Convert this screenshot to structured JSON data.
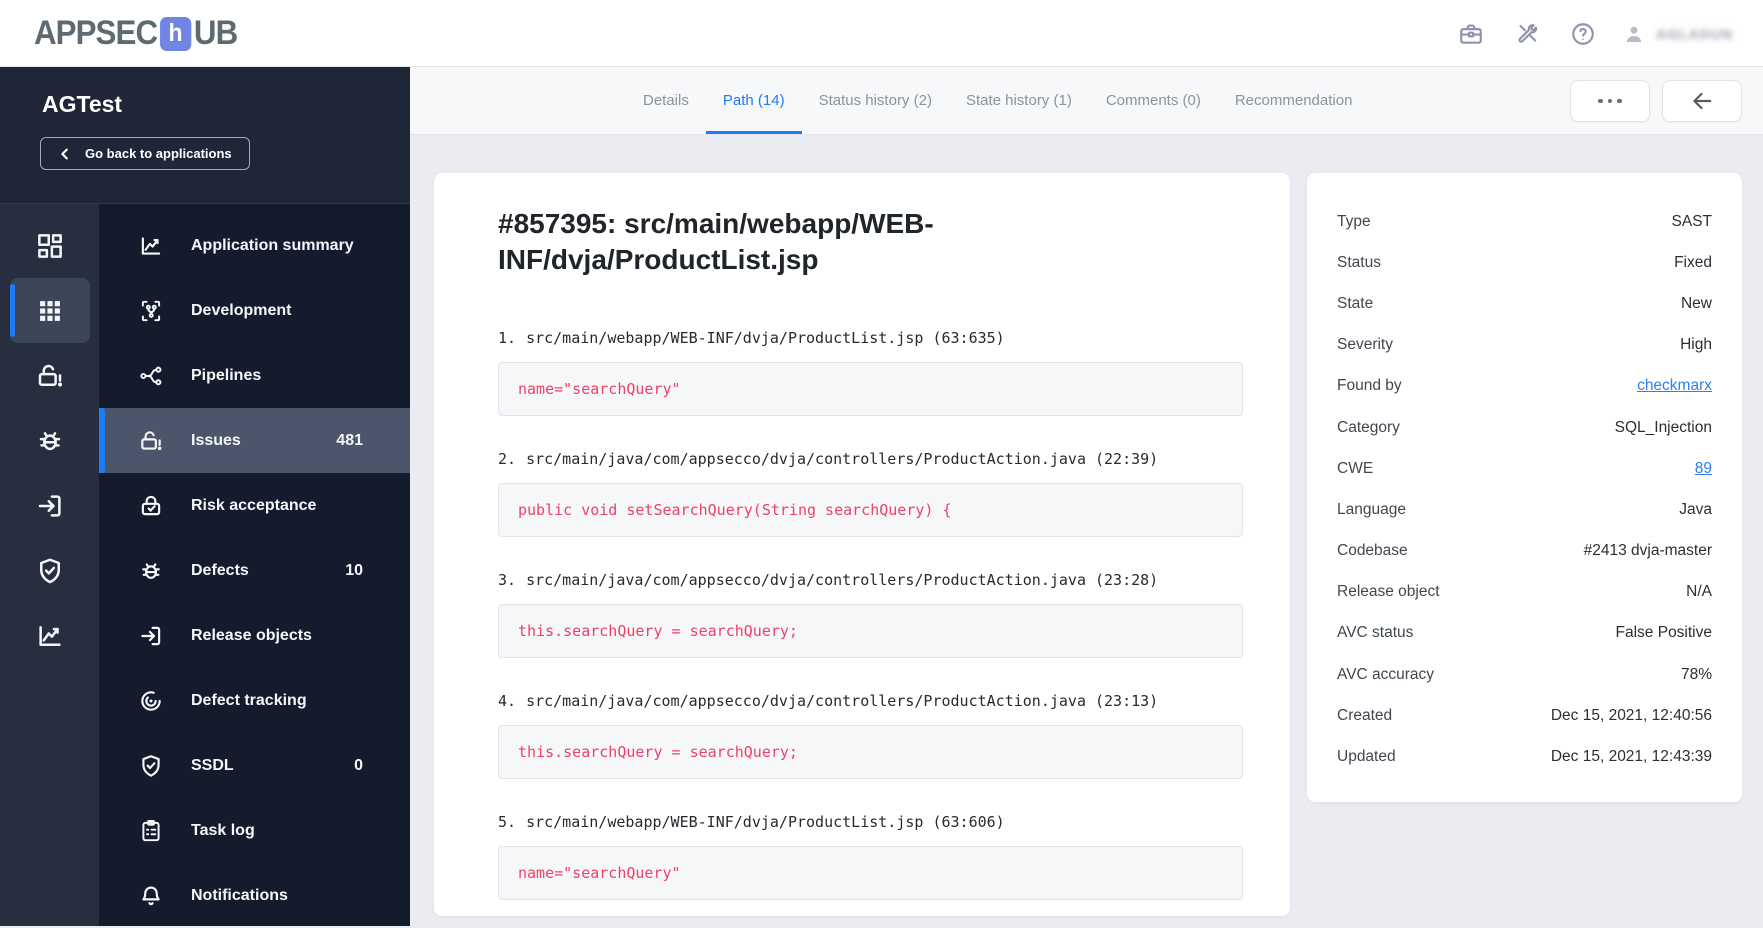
{
  "topbar": {
    "logo": {
      "prefix": "APPSEC",
      "accent_letter": "h",
      "suffix": "UB"
    },
    "user": {
      "name": "AGLADUN"
    }
  },
  "sidebar": {
    "app_name": "AGTest",
    "back_button_label": "Go back to applications",
    "rail": [
      {
        "icon": "dashboard-icon",
        "active": false
      },
      {
        "icon": "apps-grid-icon",
        "active": true
      },
      {
        "icon": "unlock-alert-icon",
        "active": false
      },
      {
        "icon": "bug-icon",
        "active": false
      },
      {
        "icon": "enter-box-icon",
        "active": false
      },
      {
        "icon": "shield-check-icon",
        "active": false
      },
      {
        "icon": "line-chart-icon",
        "active": false
      }
    ],
    "items": [
      {
        "label": "Application summary",
        "count": "",
        "icon": "line-chart-icon",
        "active": false
      },
      {
        "label": "Development",
        "count": "",
        "icon": "code-branch-icon",
        "active": false
      },
      {
        "label": "Pipelines",
        "count": "",
        "icon": "pipeline-fork-icon",
        "active": false
      },
      {
        "label": "Issues",
        "count": "481",
        "icon": "unlock-alert-icon",
        "active": true
      },
      {
        "label": "Risk acceptance",
        "count": "",
        "icon": "lock-check-icon",
        "active": false
      },
      {
        "label": "Defects",
        "count": "10",
        "icon": "bug-icon",
        "active": false
      },
      {
        "label": "Release objects",
        "count": "",
        "icon": "enter-box-icon",
        "active": false
      },
      {
        "label": "Defect tracking",
        "count": "",
        "icon": "radar-icon",
        "active": false
      },
      {
        "label": "SSDL",
        "count": "0",
        "icon": "shield-check-icon",
        "active": false
      },
      {
        "label": "Task log",
        "count": "",
        "icon": "clipboard-list-icon",
        "active": false
      },
      {
        "label": "Notifications",
        "count": "",
        "icon": "bell-icon",
        "active": false
      }
    ]
  },
  "tabs": [
    {
      "label": "Details",
      "active": false
    },
    {
      "label": "Path (14)",
      "active": true
    },
    {
      "label": "Status history (2)",
      "active": false
    },
    {
      "label": "State history (1)",
      "active": false
    },
    {
      "label": "Comments (0)",
      "active": false
    },
    {
      "label": "Recommendation",
      "active": false
    }
  ],
  "issue": {
    "title": "#857395: src/main/webapp/WEB-INF/dvja/ProductList.jsp",
    "path_steps": [
      {
        "num": "1.",
        "location": "src/main/webapp/WEB-INF/dvja/ProductList.jsp (63:635)",
        "code": "name=\"searchQuery\""
      },
      {
        "num": "2.",
        "location": "src/main/java/com/appsecco/dvja/controllers/ProductAction.java (22:39)",
        "code": "public void setSearchQuery(String searchQuery) {"
      },
      {
        "num": "3.",
        "location": "src/main/java/com/appsecco/dvja/controllers/ProductAction.java (23:28)",
        "code": "this.searchQuery = searchQuery;"
      },
      {
        "num": "4.",
        "location": "src/main/java/com/appsecco/dvja/controllers/ProductAction.java (23:13)",
        "code": "this.searchQuery = searchQuery;"
      },
      {
        "num": "5.",
        "location": "src/main/webapp/WEB-INF/dvja/ProductList.jsp (63:606)",
        "code": "name=\"searchQuery\""
      }
    ]
  },
  "details_panel": {
    "rows": [
      {
        "label": "Type",
        "value": "SAST",
        "link": false
      },
      {
        "label": "Status",
        "value": "Fixed",
        "link": false
      },
      {
        "label": "State",
        "value": "New",
        "link": false
      },
      {
        "label": "Severity",
        "value": "High",
        "link": false
      },
      {
        "label": "Found by",
        "value": "checkmarx",
        "link": true
      },
      {
        "label": "Category",
        "value": "SQL_Injection",
        "link": false
      },
      {
        "label": "CWE",
        "value": "89",
        "link": true
      },
      {
        "label": "Language",
        "value": "Java",
        "link": false
      },
      {
        "label": "Codebase",
        "value": "#2413 dvja-master",
        "link": false
      },
      {
        "label": "Release object",
        "value": "N/A",
        "link": false
      },
      {
        "label": "AVC status",
        "value": "False Positive",
        "link": false
      },
      {
        "label": "AVC accuracy",
        "value": "78%",
        "link": false
      },
      {
        "label": "Created",
        "value": "Dec 15, 2021, 12:40:56",
        "link": false
      },
      {
        "label": "Updated",
        "value": "Dec 15, 2021, 12:43:39",
        "link": false
      }
    ]
  },
  "colors": {
    "accent_blue": "#1f7cf5",
    "code_red": "#ee4167",
    "sidebar_menu_bg": "#141b2c",
    "sidebar_rail_bg": "#262e3f",
    "logo_accent": "#7186e4"
  }
}
